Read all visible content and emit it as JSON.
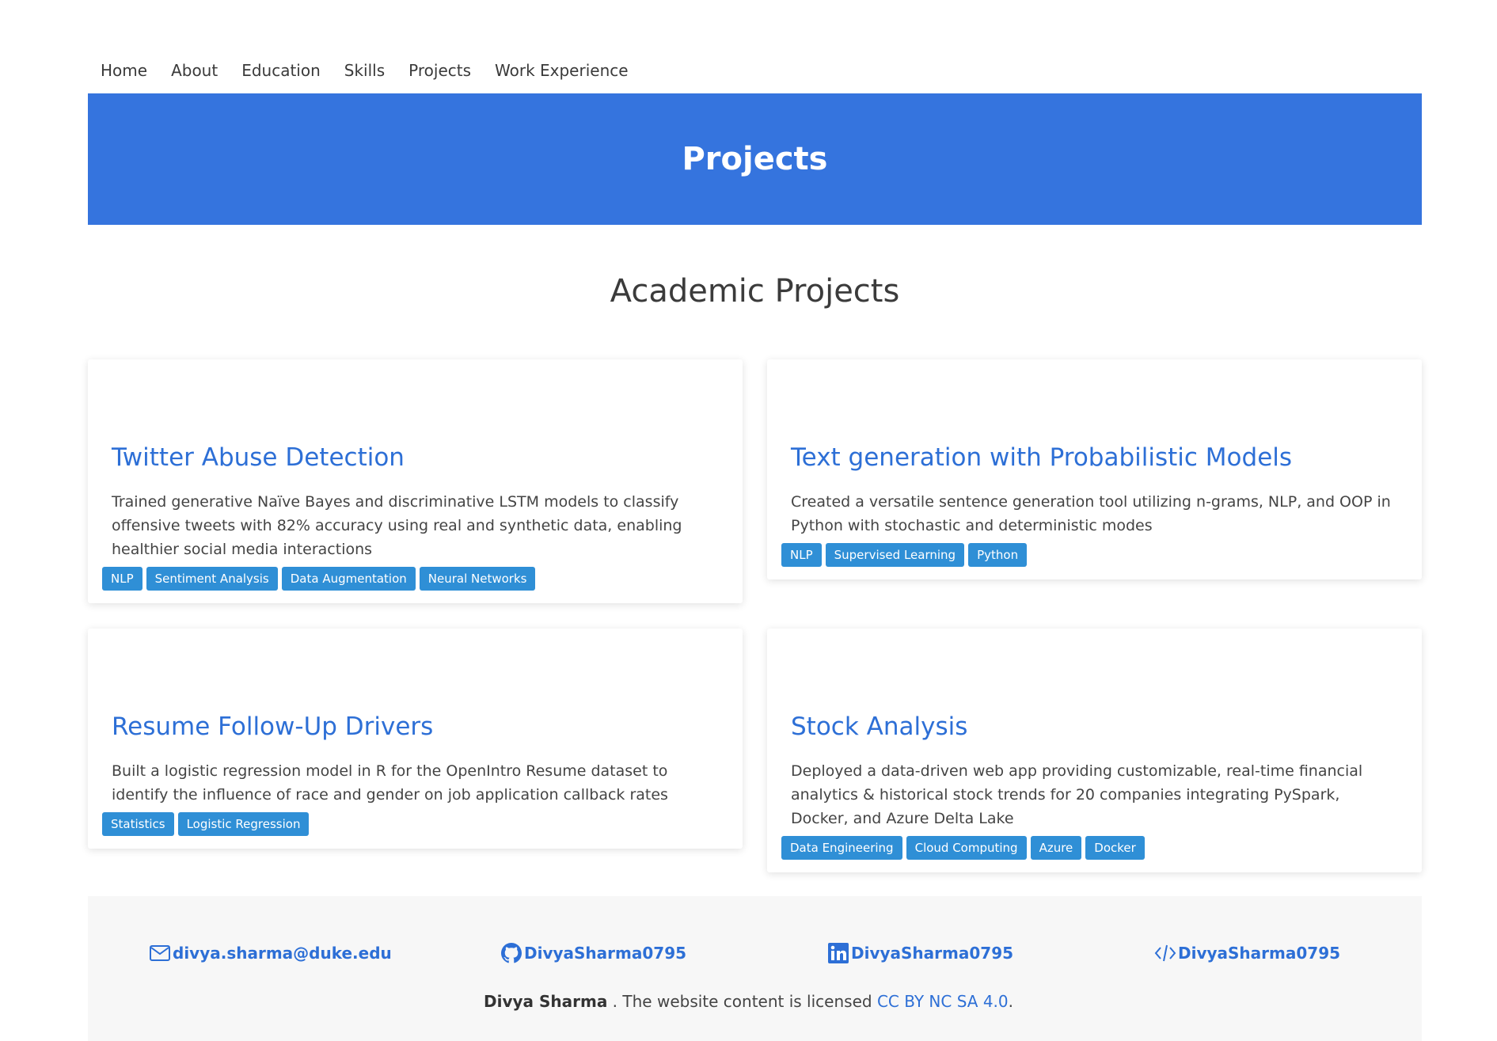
{
  "nav": {
    "items": [
      "Home",
      "About",
      "Education",
      "Skills",
      "Projects",
      "Work Experience"
    ]
  },
  "banner": {
    "title": "Projects"
  },
  "section": {
    "title": "Academic Projects"
  },
  "projects": [
    {
      "title": "Twitter Abuse Detection",
      "description": "Trained generative Naïve Bayes and discriminative LSTM models to classify offensive tweets with 82% accuracy using real and synthetic data, enabling healthier social media interactions",
      "tags": [
        "NLP",
        "Sentiment Analysis",
        "Data Augmentation",
        "Neural Networks"
      ]
    },
    {
      "title": "Text generation with Probabilistic Models",
      "description": "Created a versatile sentence generation tool utilizing n-grams, NLP, and OOP in Python with stochastic and deterministic modes",
      "tags": [
        "NLP",
        "Supervised Learning",
        "Python"
      ]
    },
    {
      "title": "Resume Follow-Up Drivers",
      "description": "Built a logistic regression model in R for the OpenIntro Resume dataset to identify the influence of race and gender on job application callback rates",
      "tags": [
        "Statistics",
        "Logistic Regression"
      ]
    },
    {
      "title": "Stock Analysis",
      "description": "Deployed a data-driven web app providing customizable, real-time financial analytics & historical stock trends for 20 companies integrating PySpark, Docker, and Azure Delta Lake",
      "tags": [
        "Data Engineering",
        "Cloud Computing",
        "Azure",
        "Docker"
      ]
    }
  ],
  "footer": {
    "email": "divya.sharma@duke.edu",
    "github": "DivyaSharma0795",
    "linkedin": "DivyaSharma0795",
    "code": "DivyaSharma0795",
    "author": "Divya Sharma",
    "license_text": " . The website content is licensed ",
    "license_link": "CC BY NC SA 4.0",
    "license_end": "."
  },
  "colors": {
    "accent": "#3574de",
    "link": "#2d6fd6",
    "tag": "#2f8fd6"
  },
  "icons": {
    "email": "envelope-icon",
    "github": "github-icon",
    "linkedin": "linkedin-icon",
    "code": "code-icon"
  }
}
